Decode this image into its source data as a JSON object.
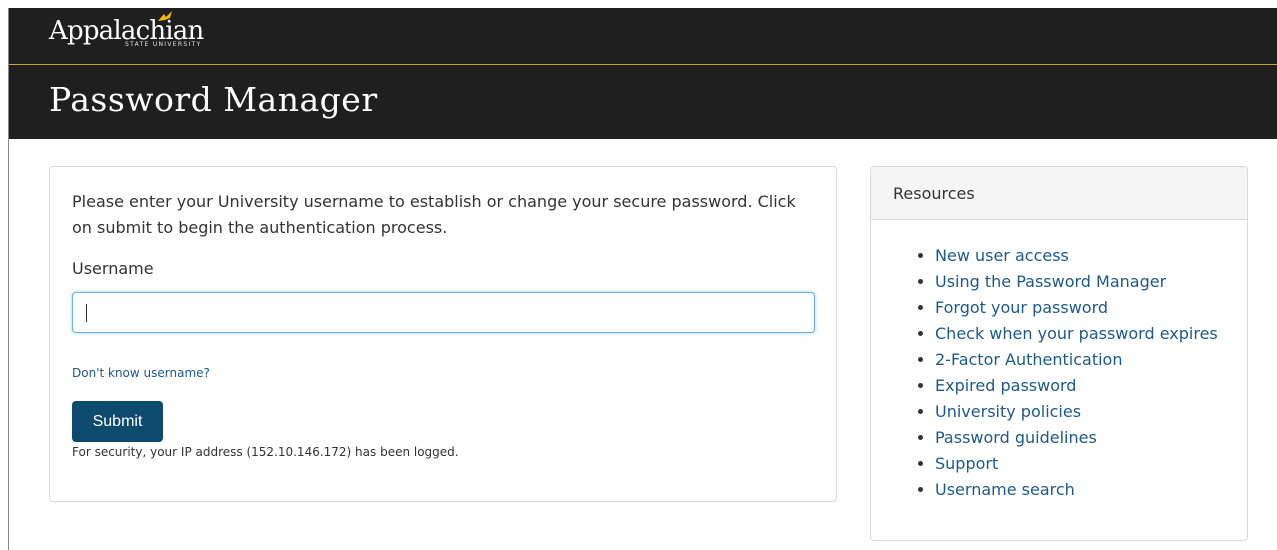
{
  "header": {
    "logo_text": "Appalachian",
    "logo_subtext": "STATE UNIVERSITY",
    "page_title": "Password Manager"
  },
  "form": {
    "intro_text": "Please enter your University username to establish or change your secure password. Click on submit to begin the authentication process.",
    "username_label": "Username",
    "username_value": "",
    "dont_know_link": "Don't know username?",
    "submit_label": "Submit",
    "security_note": "For security, your IP address (152.10.146.172) has been logged."
  },
  "resources": {
    "title": "Resources",
    "items": [
      "New user access",
      "Using the Password Manager",
      "Forgot your password",
      "Check when your password expires",
      "2-Factor Authentication",
      "Expired password",
      "University policies",
      "Password guidelines",
      "Support",
      "Username search"
    ]
  },
  "colors": {
    "header_bg": "#1f1f1f",
    "accent_gold": "#c9a13a",
    "link": "#1d5a8a",
    "button_bg": "#0c4b6e"
  }
}
